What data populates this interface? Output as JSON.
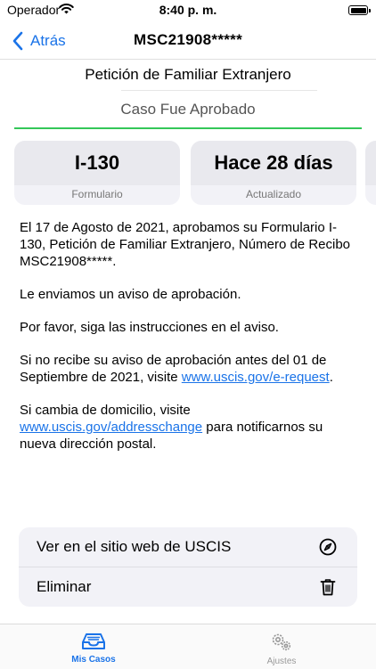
{
  "status_bar": {
    "carrier": "Operador",
    "time": "8:40 p. m.",
    "icons": [
      "wifi-icon",
      "battery-icon"
    ]
  },
  "nav": {
    "back_label": "Atrás",
    "title": "MSC21908*****"
  },
  "header": {
    "form_name": "Petición de Familiar Extranjero",
    "status": "Caso Fue Aprobado"
  },
  "cards": [
    {
      "value": "I-130",
      "label": "Formulario"
    },
    {
      "value": "Hace 28 días",
      "label": "Actualizado"
    }
  ],
  "message": {
    "p1": "El 17 de Agosto de 2021, aprobamos su Formulario I-130, Petición de Familiar Extranjero, Número de Recibo MSC21908*****.",
    "p2": "Le enviamos un aviso de aprobación.",
    "p3": "Por favor, siga las instrucciones en el aviso.",
    "p4_before": "Si no recibe su aviso de aprobación antes del 01 de Septiembre de 2021, visite ",
    "p4_link": "www.uscis.gov/e-request",
    "p4_after": ".",
    "p5_before": "Si cambia de domicilio, visite ",
    "p5_link": "www.uscis.gov/addresschange",
    "p5_after": " para notificarnos su nueva dirección postal."
  },
  "actions": [
    {
      "label": "Ver en el sitio web de USCIS",
      "icon": "compass-icon"
    },
    {
      "label": "Eliminar",
      "icon": "trash-icon"
    }
  ],
  "tabbar": [
    {
      "label": "Mis Casos",
      "icon": "tray-icon",
      "selected": true
    },
    {
      "label": "Ajustes",
      "icon": "gears-icon",
      "selected": false
    }
  ],
  "colors": {
    "accent": "#1a73e8",
    "success": "#34c759",
    "card_bg": "#f2f2f7"
  }
}
